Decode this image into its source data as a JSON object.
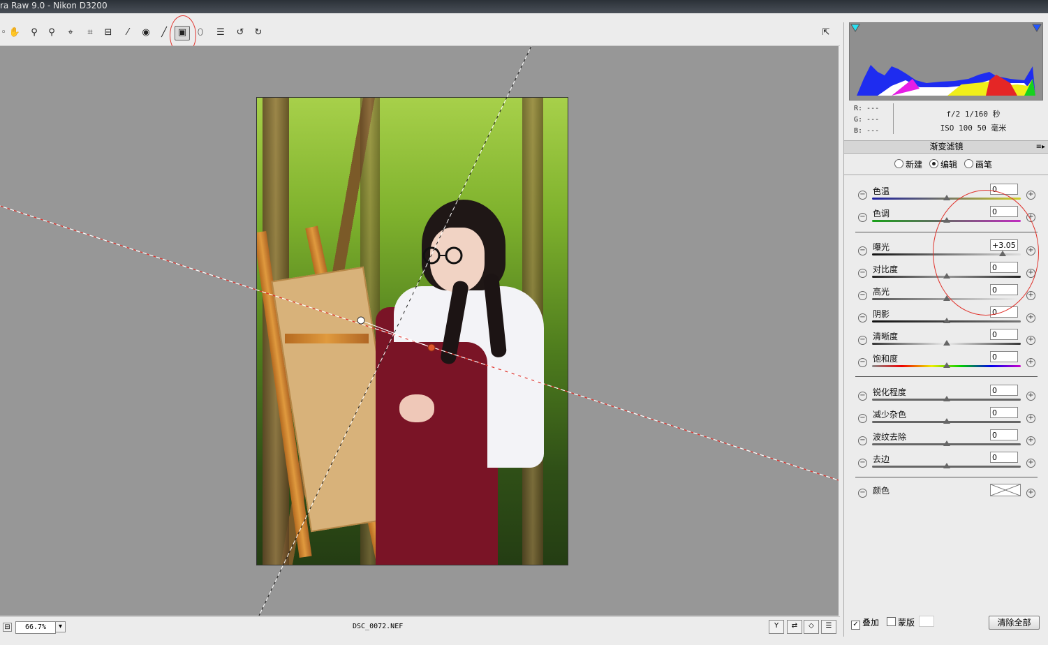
{
  "window": {
    "title": "ra Raw 9.0 -  Nikon D3200"
  },
  "toolbar": {
    "tools": [
      {
        "name": "zoom-tool",
        "glyph": "◦"
      },
      {
        "name": "hand-tool",
        "glyph": "✋"
      },
      {
        "name": "white-balance-tool",
        "glyph": "⚲"
      },
      {
        "name": "color-sampler-tool",
        "glyph": "⚲"
      },
      {
        "name": "targeted-adjustment-tool",
        "glyph": "⌖"
      },
      {
        "name": "crop-tool",
        "glyph": "⌗"
      },
      {
        "name": "straighten-tool",
        "glyph": "⊟"
      },
      {
        "name": "spot-removal-tool",
        "glyph": "⁄"
      },
      {
        "name": "red-eye-removal-tool",
        "glyph": "◉"
      },
      {
        "name": "adjustment-brush-tool",
        "glyph": "╱"
      },
      {
        "name": "graduated-filter-tool",
        "glyph": "▣"
      },
      {
        "name": "radial-filter-tool",
        "glyph": "⬯"
      },
      {
        "name": "preferences-tool",
        "glyph": "☰"
      },
      {
        "name": "rotate-left-tool",
        "glyph": "↺"
      },
      {
        "name": "rotate-right-tool",
        "glyph": "↻"
      }
    ],
    "fullscreen_glyph": "⇱"
  },
  "status": {
    "zoom": "66.7%",
    "zoom_minus": "⊟",
    "zoom_arrow": "▾",
    "filename": "DSC_0072.NEF",
    "view_buttons": [
      "Y",
      "⇄",
      "◇",
      "☰"
    ]
  },
  "histogram": {
    "r": "R:  ---",
    "g": "G:  ---",
    "b": "B:  ---",
    "aperture_shutter": "f/2   1/160 秒",
    "iso_focal": "ISO 100   50 毫米"
  },
  "panel": {
    "title": "渐变滤镜",
    "menu_glyph": "≡▸",
    "modes": [
      {
        "label": "新建",
        "selected": false
      },
      {
        "label": "编辑",
        "selected": true
      },
      {
        "label": "画笔",
        "selected": false
      }
    ],
    "sliders": [
      {
        "label": "色温",
        "value": "0",
        "level": 0.5
      },
      {
        "label": "色调",
        "value": "0",
        "level": 0.5
      },
      {
        "label": "曝光",
        "value": "+3.05",
        "level": 0.88
      },
      {
        "label": "对比度",
        "value": "0",
        "level": 0.5
      },
      {
        "label": "高光",
        "value": "0",
        "level": 0.5
      },
      {
        "label": "阴影",
        "value": "0",
        "level": 0.5
      },
      {
        "label": "清晰度",
        "value": "0",
        "level": 0.5
      },
      {
        "label": "饱和度",
        "value": "0",
        "level": 0.5
      },
      {
        "label": "锐化程度",
        "value": "0",
        "level": 0.5
      },
      {
        "label": "减少杂色",
        "value": "0",
        "level": 0.5
      },
      {
        "label": "波纹去除",
        "value": "0",
        "level": 0.5
      },
      {
        "label": "去边",
        "value": "0",
        "level": 0.5
      }
    ],
    "color_label": "颜色",
    "overlay_label": "叠加",
    "overlay_checked": true,
    "mask_label": "蒙版",
    "mask_checked": false,
    "clear_all_label": "清除全部",
    "minus_glyph": "−",
    "plus_glyph": "+"
  },
  "colors": {
    "accent_red": "#e0322b",
    "canvas_gray": "#979797"
  }
}
